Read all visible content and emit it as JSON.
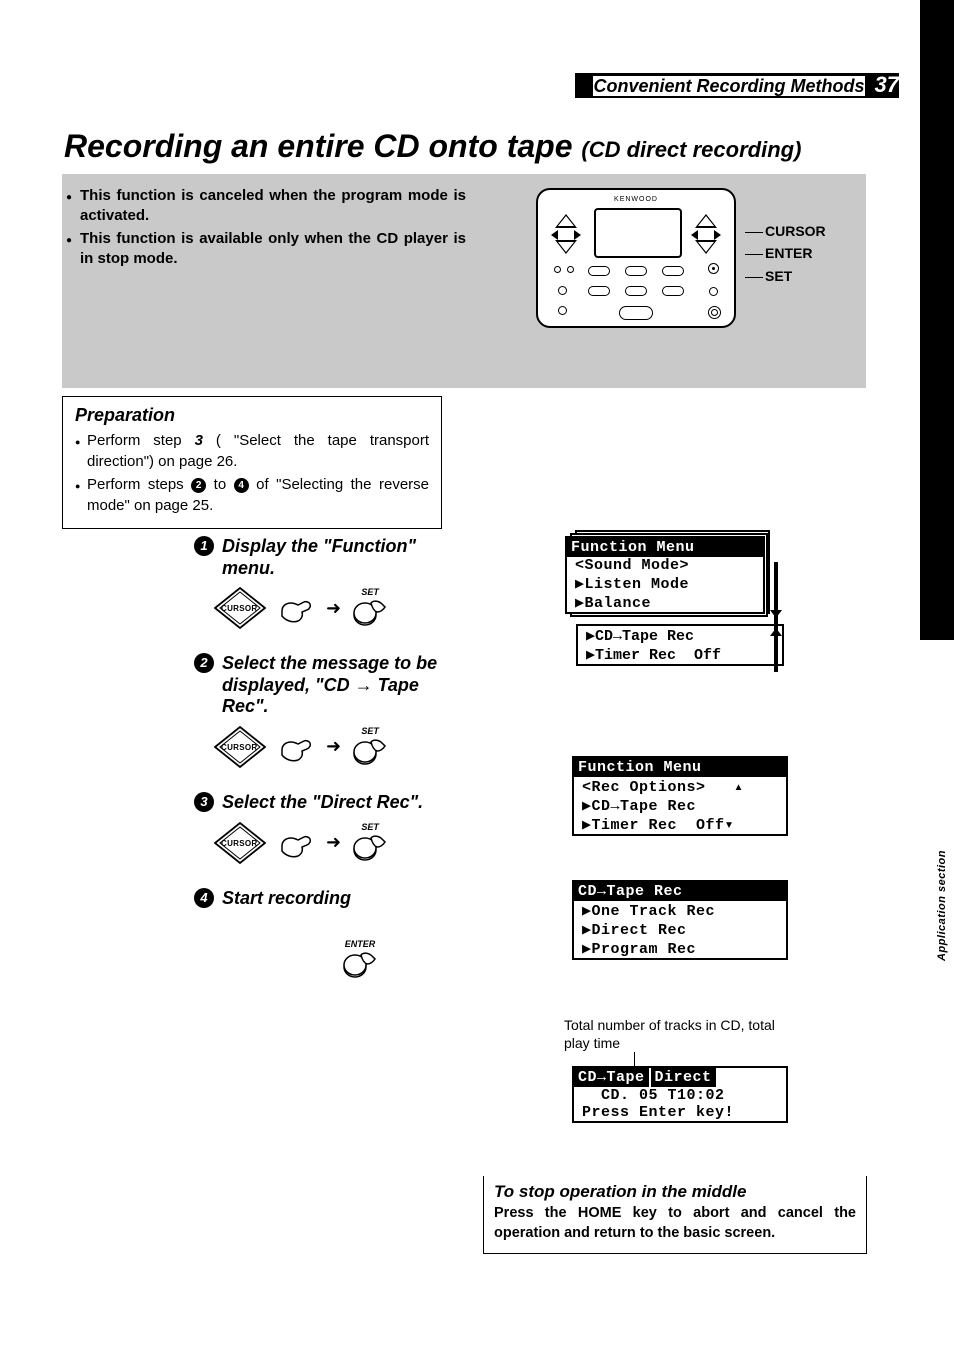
{
  "header": {
    "section": "Convenient Recording Methods",
    "page": "37"
  },
  "title": {
    "main": "Recording an entire CD onto tape",
    "sub": "(CD direct recording)"
  },
  "intro": [
    "This function is canceled when the program mode is activated.",
    "This function is available only when the CD player is in stop mode."
  ],
  "remote": {
    "brand": "KENWOOD",
    "labels": [
      "CURSOR",
      "ENTER",
      "SET"
    ]
  },
  "preparation": {
    "heading": "Preparation",
    "items": [
      {
        "pre": "Perform step ",
        "boldnum": "3",
        "post": " ( \"Select the tape transport direction\") on page 26."
      },
      {
        "pre": "Perform steps ",
        "c1": "2",
        "mid": " to ",
        "c2": "4",
        "post": " of  \"Selecting the reverse mode\" on page 25."
      }
    ]
  },
  "steps": [
    {
      "num": "1",
      "text": "Display the \"Function\" menu.",
      "diagram": "cursor-set"
    },
    {
      "num": "2",
      "text": "Select the message to be displayed, \"CD → Tape Rec\".",
      "diagram": "cursor-set"
    },
    {
      "num": "3",
      "text": "Select the \"Direct Rec\".",
      "diagram": "cursor-set"
    },
    {
      "num": "4",
      "text": "Start recording",
      "diagram": "enter"
    }
  ],
  "ui_labels": {
    "cursor": "CURSOR",
    "set": "SET",
    "enter": "ENTER"
  },
  "lcd1": {
    "title": "Function Menu",
    "lines": [
      "<Sound Mode>",
      "▶Listen Mode",
      "▶Balance"
    ]
  },
  "lcd1b": {
    "lines": [
      "▶CD→Tape Rec",
      "▶Timer Rec  Off"
    ]
  },
  "lcd2": {
    "title": "Function Menu",
    "lines": [
      "<Rec Options>   ▴",
      "▶CD→Tape Rec",
      "▶Timer Rec  Off▾"
    ]
  },
  "lcd3": {
    "title": "CD→Tape Rec",
    "lines": [
      "▶One Track Rec",
      "▶Direct Rec",
      "▶Program Rec"
    ]
  },
  "tracks_note": "Total number of tracks in CD, total play time",
  "lcd4": {
    "title1": "CD→Tape",
    "title2": "Direct",
    "lines": [
      "  CD. 05 T10:02",
      "",
      "Press Enter key!"
    ]
  },
  "stop": {
    "heading": "To stop operation in the middle",
    "body": "Press the HOME key to abort and cancel the operation and return to the basic screen."
  },
  "side_tab": "Application section"
}
